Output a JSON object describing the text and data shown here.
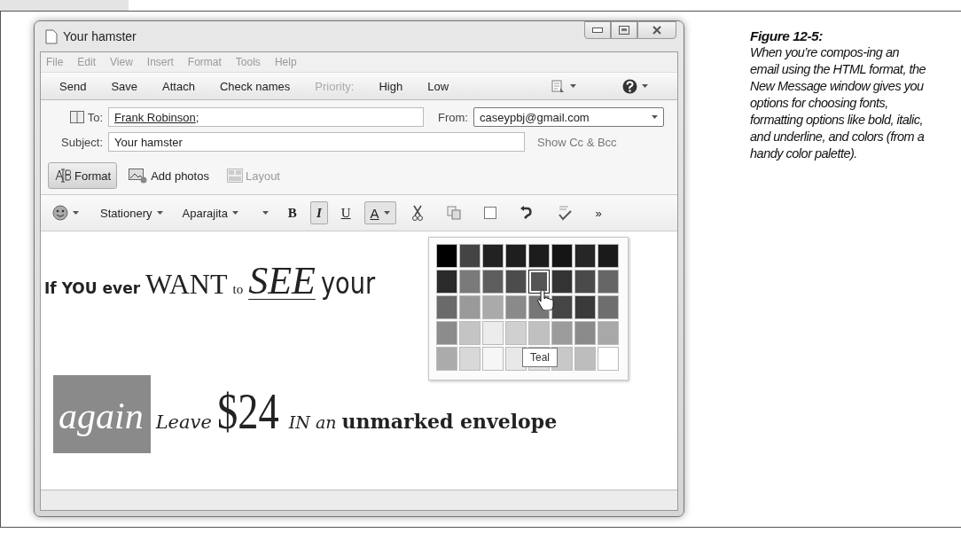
{
  "window": {
    "title": "Your hamster"
  },
  "menu": [
    "File",
    "Edit",
    "View",
    "Insert",
    "Format",
    "Tools",
    "Help"
  ],
  "toolbar": [
    {
      "label": "Send",
      "disabled": false
    },
    {
      "label": "Save",
      "disabled": false
    },
    {
      "label": "Attach",
      "disabled": false
    },
    {
      "label": "Check names",
      "disabled": false
    },
    {
      "label": "Priority:",
      "disabled": true
    },
    {
      "label": "High",
      "disabled": false
    },
    {
      "label": "Low",
      "disabled": false
    }
  ],
  "header": {
    "to_label": "To:",
    "to_value": "Frank Robinson",
    "to_separator": ";",
    "from_label": "From:",
    "from_value": "caseypbj@gmail.com",
    "subject_label": "Subject:",
    "subject_value": "Your hamster",
    "cc_link": "Show Cc & Bcc"
  },
  "options": [
    {
      "label": "Format",
      "pressed": true,
      "disabled": false
    },
    {
      "label": "Add photos",
      "pressed": false,
      "disabled": false
    },
    {
      "label": "Layout",
      "pressed": false,
      "disabled": true
    }
  ],
  "format_toolbar": {
    "stationery": "Stationery",
    "font": "Aparajita",
    "bold": {
      "label": "B",
      "pressed": false
    },
    "italic": {
      "label": "I",
      "pressed": true
    },
    "underline": {
      "label": "U",
      "pressed": false
    },
    "font_color": {
      "label": "A",
      "pressed": true
    },
    "more": "»"
  },
  "body": {
    "lines": [
      [
        {
          "text": "If YOU ever",
          "kind": "heavy-sans"
        },
        {
          "text": "WANT",
          "kind": "serif-large"
        },
        {
          "text": "to",
          "kind": "serif-small"
        },
        {
          "text": "SEE",
          "kind": "italic-underline"
        },
        {
          "text": "your",
          "kind": "condensed"
        }
      ],
      [
        {
          "text": "again",
          "kind": "highlight"
        },
        {
          "text": "Leave",
          "kind": "script"
        },
        {
          "text": "$24",
          "kind": "tall-serif"
        },
        {
          "text": "IN an",
          "kind": "italic-small"
        },
        {
          "text": "unmarked envelope",
          "kind": "heavy-serif"
        }
      ]
    ]
  },
  "palette": {
    "tooltip": "Teal",
    "swatches": [
      {
        "color": "#000000",
        "selected": false
      },
      {
        "color": "#444444",
        "selected": false
      },
      {
        "color": "#222222",
        "selected": false
      },
      {
        "color": "#1e1e1e",
        "selected": false
      },
      {
        "color": "#1c1c1c",
        "selected": false
      },
      {
        "color": "#151515",
        "selected": false
      },
      {
        "color": "#262626",
        "selected": false
      },
      {
        "color": "#1a1a1a",
        "selected": false
      },
      {
        "color": "#2a2a2a",
        "selected": false
      },
      {
        "color": "#7a7a7a",
        "selected": false
      },
      {
        "color": "#5e5e5e",
        "selected": false
      },
      {
        "color": "#4c4c4c",
        "selected": false
      },
      {
        "color": "#555555",
        "selected": true
      },
      {
        "color": "#333333",
        "selected": false
      },
      {
        "color": "#4a4a4a",
        "selected": false
      },
      {
        "color": "#666666",
        "selected": false
      },
      {
        "color": "#6a6a6a",
        "selected": false
      },
      {
        "color": "#9a9a9a",
        "selected": false
      },
      {
        "color": "#aaaaaa",
        "selected": false
      },
      {
        "color": "#8a8a8a",
        "selected": false
      },
      {
        "color": "#777777",
        "selected": false
      },
      {
        "color": "#454545",
        "selected": false
      },
      {
        "color": "#3a3a3a",
        "selected": false
      },
      {
        "color": "#6e6e6e",
        "selected": false
      },
      {
        "color": "#8c8c8c",
        "selected": false
      },
      {
        "color": "#c4c4c4",
        "selected": false
      },
      {
        "color": "#ececec",
        "selected": false
      },
      {
        "color": "#d0d0d0",
        "selected": false
      },
      {
        "color": "#c0c0c0",
        "selected": false
      },
      {
        "color": "#9c9c9c",
        "selected": false
      },
      {
        "color": "#8b8b8b",
        "selected": false
      },
      {
        "color": "#a8a8a8",
        "selected": false
      },
      {
        "color": "#ababab",
        "selected": false
      },
      {
        "color": "#d8d8d8",
        "selected": false
      },
      {
        "color": "#f6f6f6",
        "selected": false
      },
      {
        "color": "#e8e8e8",
        "selected": false
      },
      {
        "color": "#e0e0e0",
        "selected": false
      },
      {
        "color": "#c8c8c8",
        "selected": false
      },
      {
        "color": "#bdbdbd",
        "selected": false
      },
      {
        "color": "#ffffff",
        "selected": false
      }
    ]
  },
  "caption": {
    "title": "Figure 12-5:",
    "text": "When you’re compos-ing an email using the HTML format, the New Message window gives you options for choosing fonts, formatting options like bold, italic, and underline, and colors (from a handy color palette)."
  }
}
